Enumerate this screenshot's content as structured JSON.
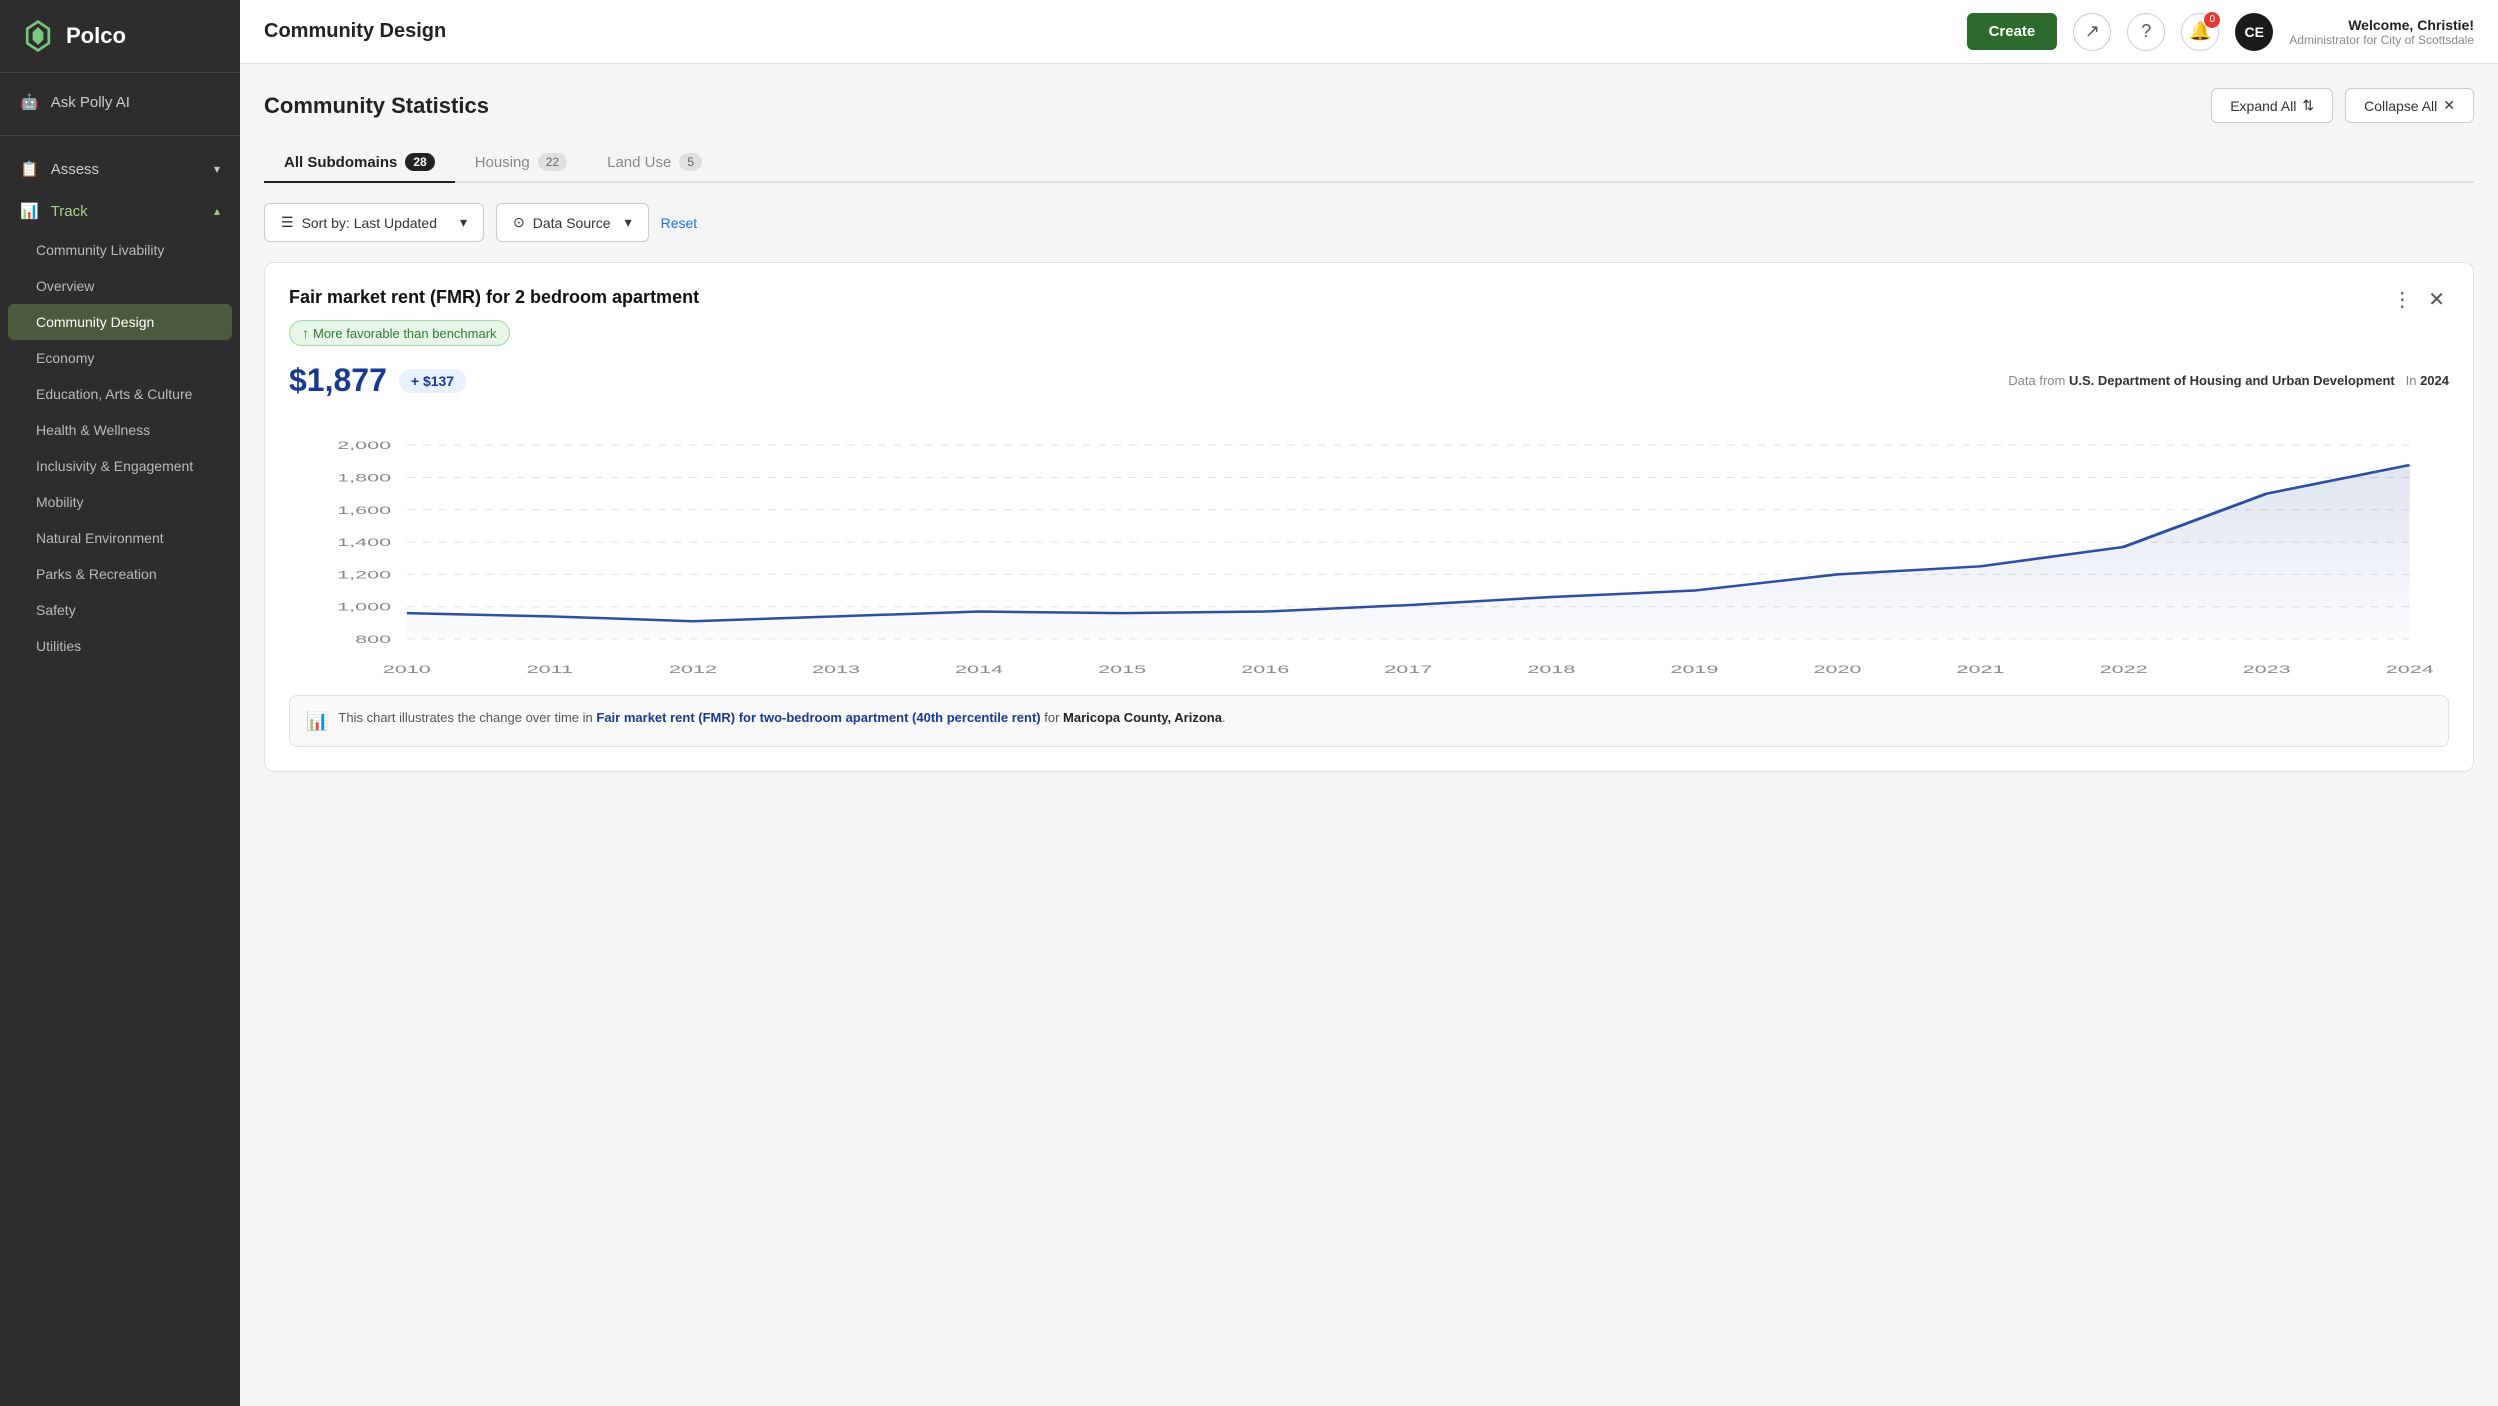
{
  "sidebar": {
    "logo_text": "Polco",
    "top_items": [
      {
        "id": "ask-polly",
        "label": "Ask Polly AI",
        "icon": "🤖"
      }
    ],
    "nav_items": [
      {
        "id": "assess",
        "label": "Assess",
        "icon": "📋",
        "has_chevron": true,
        "expanded": false
      },
      {
        "id": "track",
        "label": "Track",
        "icon": "📊",
        "has_chevron": true,
        "expanded": true
      }
    ],
    "sub_items": [
      {
        "id": "community-livability",
        "label": "Community Livability",
        "active": false
      },
      {
        "id": "overview",
        "label": "Overview",
        "active": false
      },
      {
        "id": "community-design",
        "label": "Community Design",
        "active": true
      },
      {
        "id": "economy",
        "label": "Economy",
        "active": false
      },
      {
        "id": "education-arts-culture",
        "label": "Education, Arts & Culture",
        "active": false
      },
      {
        "id": "health-wellness",
        "label": "Health & Wellness",
        "active": false
      },
      {
        "id": "inclusivity-engagement",
        "label": "Inclusivity & Engagement",
        "active": false
      },
      {
        "id": "mobility",
        "label": "Mobility",
        "active": false
      },
      {
        "id": "natural-environment",
        "label": "Natural Environment",
        "active": false
      },
      {
        "id": "parks-recreation",
        "label": "Parks & Recreation",
        "active": false
      },
      {
        "id": "safety",
        "label": "Safety",
        "active": false
      },
      {
        "id": "utilities",
        "label": "Utilities",
        "active": false
      }
    ]
  },
  "header": {
    "title": "Community Design",
    "create_label": "Create",
    "user_name": "Welcome, Christie!",
    "user_role": "Administrator for City of Scottsdale",
    "avatar_initials": "CE",
    "notification_count": "0"
  },
  "page": {
    "title": "Community Statistics",
    "expand_all": "Expand All",
    "collapse_all": "Collapse All"
  },
  "tabs": [
    {
      "id": "all-subdomains",
      "label": "All Subdomains",
      "count": "28",
      "active": true
    },
    {
      "id": "housing",
      "label": "Housing",
      "count": "22",
      "active": false
    },
    {
      "id": "land-use",
      "label": "Land Use",
      "count": "5",
      "active": false
    }
  ],
  "filters": {
    "sort_label": "Sort by: Last Updated",
    "data_source_label": "Data Source",
    "reset_label": "Reset"
  },
  "card": {
    "title": "Fair market rent (FMR) for 2 bedroom apartment",
    "badge_text": "More favorable than benchmark",
    "main_value": "$1,877",
    "delta": "+ $137",
    "data_source_prefix": "Data from",
    "data_source": "U.S. Department of Housing and Urban Development",
    "year_prefix": "In",
    "year": "2024",
    "description_prefix": "This chart illustrates the change over time in",
    "description_metric": "Fair market rent (FMR) for two-bedroom apartment (40th percentile rent)",
    "description_for": "for",
    "description_place": "Maricopa County, Arizona",
    "description_suffix": ".",
    "chart": {
      "years": [
        "2010",
        "2011",
        "2012",
        "2013",
        "2014",
        "2015",
        "2016",
        "2017",
        "2018",
        "2019",
        "2020",
        "2021",
        "2022",
        "2023",
        "2024"
      ],
      "values": [
        960,
        940,
        910,
        940,
        970,
        960,
        970,
        1010,
        1060,
        1100,
        1200,
        1250,
        1370,
        1700,
        1877
      ],
      "y_labels": [
        "800",
        "1,000",
        "1,200",
        "1,400",
        "1,600",
        "1,800",
        "2,000"
      ],
      "y_min": 800,
      "y_max": 2100
    }
  }
}
